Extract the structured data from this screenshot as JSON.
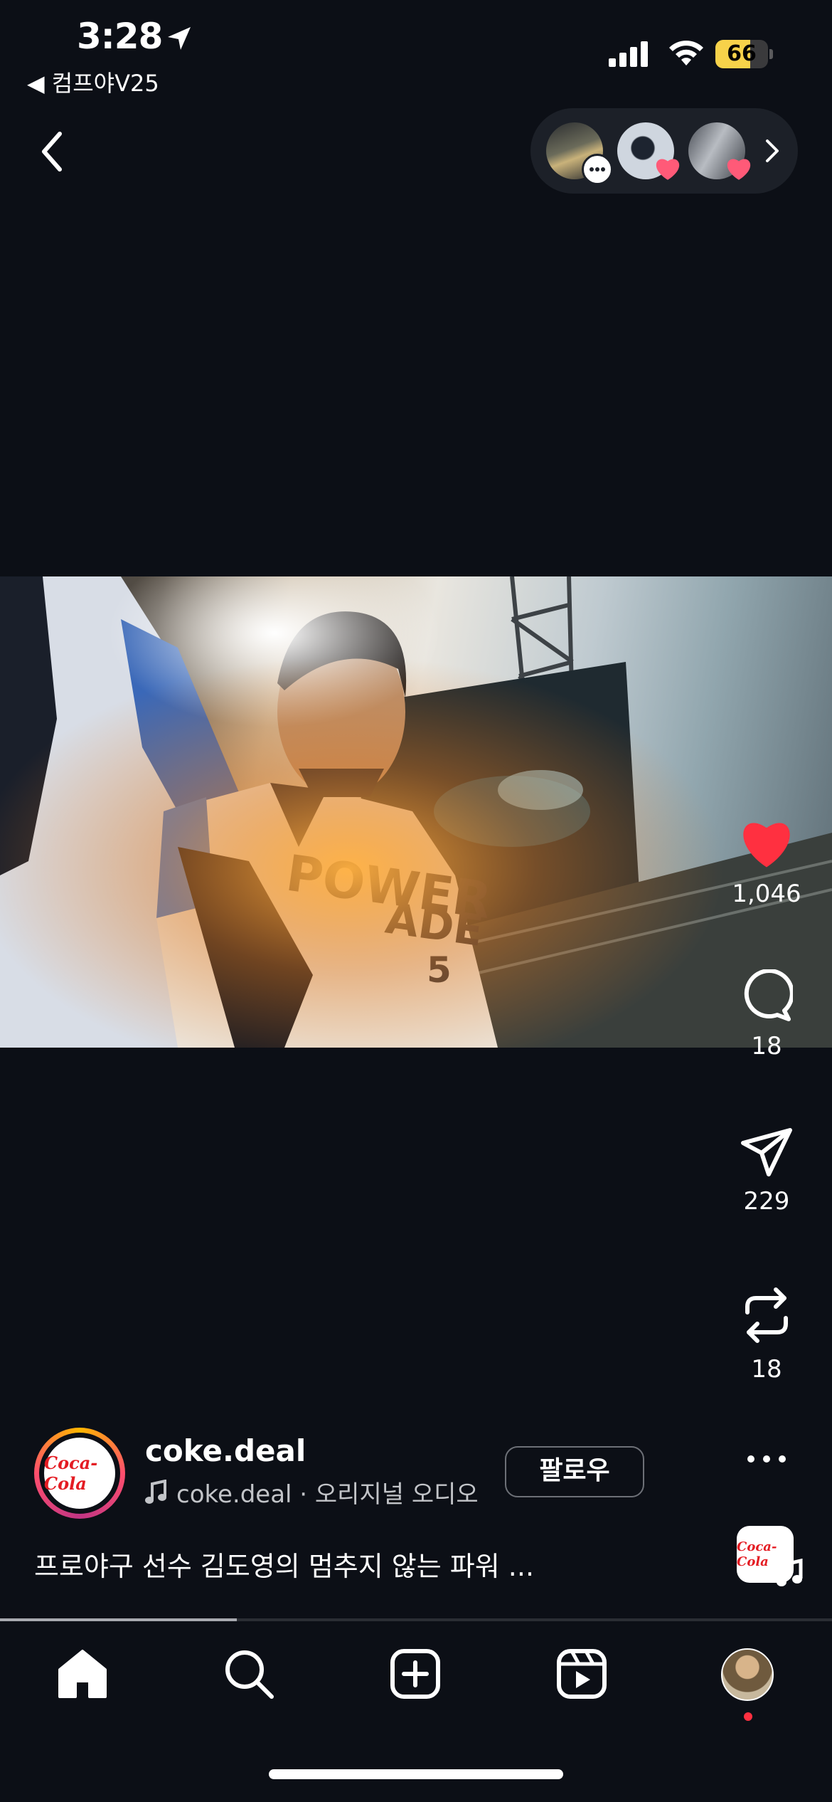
{
  "status_bar": {
    "time": "3:28",
    "back_app": "◀ 컴프야V25",
    "battery": "66"
  },
  "colors": {
    "background": "#0c0f16",
    "like_red": "#ff3040",
    "follow_border": "#6d7077",
    "battery_yellow": "#f7d24a"
  },
  "top_nav": {
    "back_icon": "chevron-left-icon",
    "viewers": [
      {
        "name": "viewer-1",
        "badge": "comment"
      },
      {
        "name": "viewer-2",
        "badge": "heart"
      },
      {
        "name": "viewer-3",
        "badge": "heart"
      }
    ]
  },
  "actions": {
    "likes": "1,046",
    "comments": "18",
    "shares": "229",
    "reposts": "18",
    "liked": true
  },
  "post": {
    "username": "coke.deal",
    "avatar_logo_text": "Coca-Cola",
    "audio_label": "coke.deal · 오리지널 오디오",
    "follow_label": "팔로우",
    "caption": "프로야구 선수 김도영의 멈추지 않는 파워 ...",
    "audio_thumb_text": "Coca-Cola"
  },
  "video": {
    "progress": 0.285
  },
  "tab_bar": {
    "items": [
      "home",
      "search",
      "create",
      "reels",
      "profile"
    ],
    "profile_has_notification": true
  }
}
